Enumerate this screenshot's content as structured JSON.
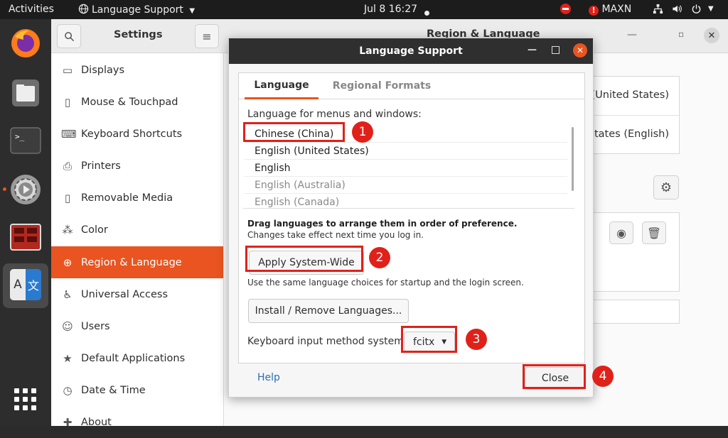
{
  "topbar": {
    "activities": "Activities",
    "app_menu": "Language Support",
    "clock": "Jul 8  16:27",
    "maxn": "MAXN"
  },
  "dock": {
    "apps": [
      "firefox-icon",
      "files-icon",
      "terminal-icon",
      "software-updater-icon",
      "system-monitor-icon",
      "language-support-icon",
      "show-apps-icon"
    ]
  },
  "settings": {
    "title": "Settings",
    "panel_title": "Region & Language",
    "sidebar": [
      {
        "label": "Displays",
        "icon": "display-icon"
      },
      {
        "label": "Mouse & Touchpad",
        "icon": "mouse-icon"
      },
      {
        "label": "Keyboard Shortcuts",
        "icon": "keyboard-icon"
      },
      {
        "label": "Printers",
        "icon": "printer-icon"
      },
      {
        "label": "Removable Media",
        "icon": "removable-media-icon"
      },
      {
        "label": "Color",
        "icon": "color-icon"
      },
      {
        "label": "Region & Language",
        "icon": "globe-icon"
      },
      {
        "label": "Universal Access",
        "icon": "accessibility-icon"
      },
      {
        "label": "Users",
        "icon": "users-icon"
      },
      {
        "label": "Default Applications",
        "icon": "star-icon"
      },
      {
        "label": "Date & Time",
        "icon": "clock-icon"
      },
      {
        "label": "About",
        "icon": "plus-icon"
      }
    ],
    "region_language": "n (United States)",
    "region_formats": "States (English)"
  },
  "dialog": {
    "title": "Language Support",
    "tabs": [
      "Language",
      "Regional Formats"
    ],
    "lang_heading": "Language for menus and windows:",
    "languages": [
      "Chinese (China)",
      "English (United States)",
      "English",
      "English (Australia)",
      "English (Canada)"
    ],
    "drag_note": "Drag languages to arrange them in order of preference.",
    "login_note": "Changes take effect next time you log in.",
    "apply_button": "Apply System-Wide",
    "apply_note": "Use the same language choices for startup and the login screen.",
    "install_button": "Install / Remove Languages...",
    "input_label": "Keyboard input method system:",
    "input_value": "fcitx",
    "help": "Help",
    "close": "Close"
  },
  "annotations": [
    "1",
    "2",
    "3",
    "4"
  ],
  "colors": {
    "accent": "#e95420",
    "annotation_red": "#e0211a",
    "link": "#2c6fb4"
  }
}
